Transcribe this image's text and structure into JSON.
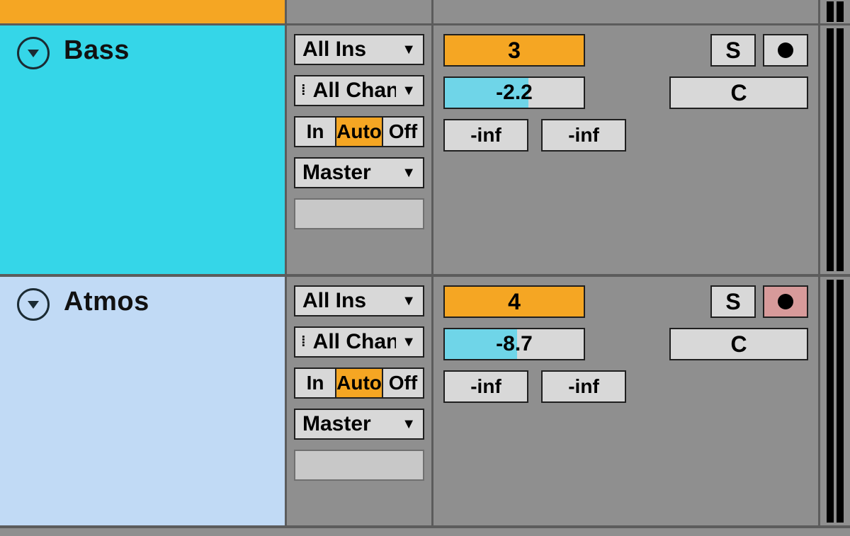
{
  "tracks": [
    {
      "id": "bass",
      "name": "Bass",
      "input_type": "All Ins",
      "input_channel": "All Channe",
      "monitor": {
        "in": "In",
        "auto": "Auto",
        "off": "Off",
        "active": "auto"
      },
      "output": "Master",
      "number": "3",
      "solo": "S",
      "record_armed": false,
      "volume": "-2.2",
      "volume_fill_pct": 60,
      "pan": "C",
      "send_a": "-inf",
      "send_b": "-inf"
    },
    {
      "id": "atmos",
      "name": "Atmos",
      "input_type": "All Ins",
      "input_channel": "All Channe",
      "monitor": {
        "in": "In",
        "auto": "Auto",
        "off": "Off",
        "active": "auto"
      },
      "output": "Master",
      "number": "4",
      "solo": "S",
      "record_armed": true,
      "volume": "-8.7",
      "volume_fill_pct": 52,
      "pan": "C",
      "send_a": "-inf",
      "send_b": "-inf"
    }
  ]
}
